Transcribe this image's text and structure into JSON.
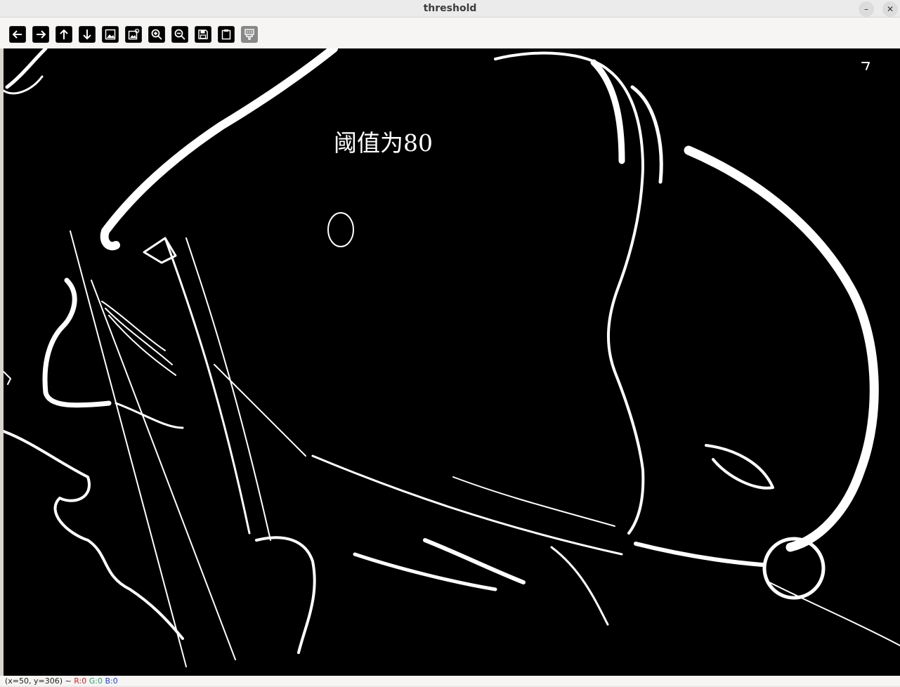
{
  "window": {
    "title": "threshold",
    "minimize_glyph": "–",
    "close_glyph": "✕"
  },
  "toolbar": {
    "buttons": [
      {
        "name": "pan-left",
        "icon": "arrow-left-icon"
      },
      {
        "name": "pan-right",
        "icon": "arrow-right-icon"
      },
      {
        "name": "pan-up",
        "icon": "arrow-up-icon"
      },
      {
        "name": "pan-down",
        "icon": "arrow-down-icon"
      },
      {
        "name": "zoom-original",
        "icon": "image-icon"
      },
      {
        "name": "zoom-fit",
        "icon": "image-fit-icon"
      },
      {
        "name": "zoom-in",
        "icon": "zoom-in-icon"
      },
      {
        "name": "zoom-out",
        "icon": "zoom-out-icon"
      },
      {
        "name": "save",
        "icon": "save-icon"
      },
      {
        "name": "properties",
        "icon": "clipboard-icon"
      },
      {
        "name": "properties-disabled",
        "icon": "brush-icon"
      }
    ]
  },
  "image": {
    "overlay_text": "阈值为80"
  },
  "status": {
    "coords": "(x=50, y=306) ~",
    "r": "R:0",
    "g": "G:0",
    "b": "B:0"
  },
  "colors": {
    "background": "#000000",
    "foreground": "#ffffff",
    "status_r": "#e01b24",
    "status_g": "#26a269",
    "status_b": "#1c3fd6"
  }
}
